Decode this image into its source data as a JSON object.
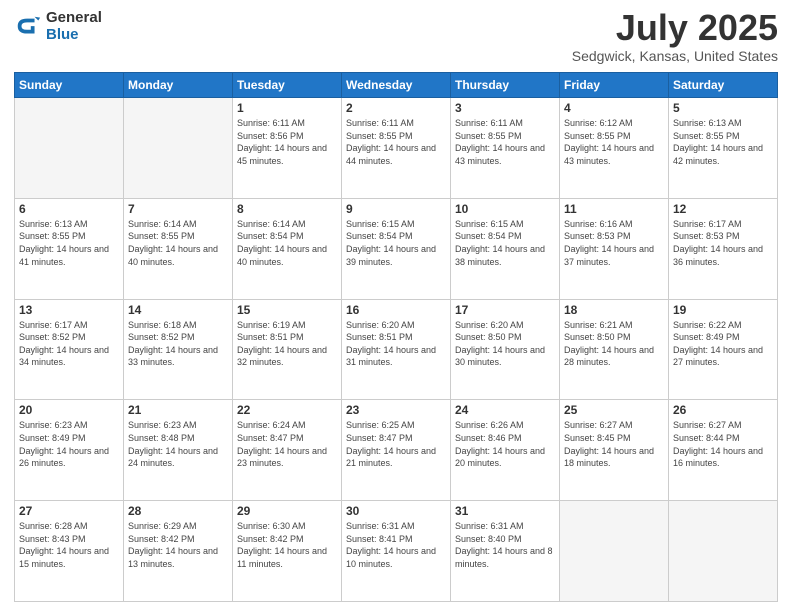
{
  "header": {
    "logo_general": "General",
    "logo_blue": "Blue",
    "title": "July 2025",
    "location": "Sedgwick, Kansas, United States"
  },
  "days_of_week": [
    "Sunday",
    "Monday",
    "Tuesday",
    "Wednesday",
    "Thursday",
    "Friday",
    "Saturday"
  ],
  "weeks": [
    [
      {
        "day": "",
        "empty": true
      },
      {
        "day": "",
        "empty": true
      },
      {
        "day": "1",
        "sunrise": "Sunrise: 6:11 AM",
        "sunset": "Sunset: 8:56 PM",
        "daylight": "Daylight: 14 hours and 45 minutes."
      },
      {
        "day": "2",
        "sunrise": "Sunrise: 6:11 AM",
        "sunset": "Sunset: 8:55 PM",
        "daylight": "Daylight: 14 hours and 44 minutes."
      },
      {
        "day": "3",
        "sunrise": "Sunrise: 6:11 AM",
        "sunset": "Sunset: 8:55 PM",
        "daylight": "Daylight: 14 hours and 43 minutes."
      },
      {
        "day": "4",
        "sunrise": "Sunrise: 6:12 AM",
        "sunset": "Sunset: 8:55 PM",
        "daylight": "Daylight: 14 hours and 43 minutes."
      },
      {
        "day": "5",
        "sunrise": "Sunrise: 6:13 AM",
        "sunset": "Sunset: 8:55 PM",
        "daylight": "Daylight: 14 hours and 42 minutes."
      }
    ],
    [
      {
        "day": "6",
        "sunrise": "Sunrise: 6:13 AM",
        "sunset": "Sunset: 8:55 PM",
        "daylight": "Daylight: 14 hours and 41 minutes."
      },
      {
        "day": "7",
        "sunrise": "Sunrise: 6:14 AM",
        "sunset": "Sunset: 8:55 PM",
        "daylight": "Daylight: 14 hours and 40 minutes."
      },
      {
        "day": "8",
        "sunrise": "Sunrise: 6:14 AM",
        "sunset": "Sunset: 8:54 PM",
        "daylight": "Daylight: 14 hours and 40 minutes."
      },
      {
        "day": "9",
        "sunrise": "Sunrise: 6:15 AM",
        "sunset": "Sunset: 8:54 PM",
        "daylight": "Daylight: 14 hours and 39 minutes."
      },
      {
        "day": "10",
        "sunrise": "Sunrise: 6:15 AM",
        "sunset": "Sunset: 8:54 PM",
        "daylight": "Daylight: 14 hours and 38 minutes."
      },
      {
        "day": "11",
        "sunrise": "Sunrise: 6:16 AM",
        "sunset": "Sunset: 8:53 PM",
        "daylight": "Daylight: 14 hours and 37 minutes."
      },
      {
        "day": "12",
        "sunrise": "Sunrise: 6:17 AM",
        "sunset": "Sunset: 8:53 PM",
        "daylight": "Daylight: 14 hours and 36 minutes."
      }
    ],
    [
      {
        "day": "13",
        "sunrise": "Sunrise: 6:17 AM",
        "sunset": "Sunset: 8:52 PM",
        "daylight": "Daylight: 14 hours and 34 minutes."
      },
      {
        "day": "14",
        "sunrise": "Sunrise: 6:18 AM",
        "sunset": "Sunset: 8:52 PM",
        "daylight": "Daylight: 14 hours and 33 minutes."
      },
      {
        "day": "15",
        "sunrise": "Sunrise: 6:19 AM",
        "sunset": "Sunset: 8:51 PM",
        "daylight": "Daylight: 14 hours and 32 minutes."
      },
      {
        "day": "16",
        "sunrise": "Sunrise: 6:20 AM",
        "sunset": "Sunset: 8:51 PM",
        "daylight": "Daylight: 14 hours and 31 minutes."
      },
      {
        "day": "17",
        "sunrise": "Sunrise: 6:20 AM",
        "sunset": "Sunset: 8:50 PM",
        "daylight": "Daylight: 14 hours and 30 minutes."
      },
      {
        "day": "18",
        "sunrise": "Sunrise: 6:21 AM",
        "sunset": "Sunset: 8:50 PM",
        "daylight": "Daylight: 14 hours and 28 minutes."
      },
      {
        "day": "19",
        "sunrise": "Sunrise: 6:22 AM",
        "sunset": "Sunset: 8:49 PM",
        "daylight": "Daylight: 14 hours and 27 minutes."
      }
    ],
    [
      {
        "day": "20",
        "sunrise": "Sunrise: 6:23 AM",
        "sunset": "Sunset: 8:49 PM",
        "daylight": "Daylight: 14 hours and 26 minutes."
      },
      {
        "day": "21",
        "sunrise": "Sunrise: 6:23 AM",
        "sunset": "Sunset: 8:48 PM",
        "daylight": "Daylight: 14 hours and 24 minutes."
      },
      {
        "day": "22",
        "sunrise": "Sunrise: 6:24 AM",
        "sunset": "Sunset: 8:47 PM",
        "daylight": "Daylight: 14 hours and 23 minutes."
      },
      {
        "day": "23",
        "sunrise": "Sunrise: 6:25 AM",
        "sunset": "Sunset: 8:47 PM",
        "daylight": "Daylight: 14 hours and 21 minutes."
      },
      {
        "day": "24",
        "sunrise": "Sunrise: 6:26 AM",
        "sunset": "Sunset: 8:46 PM",
        "daylight": "Daylight: 14 hours and 20 minutes."
      },
      {
        "day": "25",
        "sunrise": "Sunrise: 6:27 AM",
        "sunset": "Sunset: 8:45 PM",
        "daylight": "Daylight: 14 hours and 18 minutes."
      },
      {
        "day": "26",
        "sunrise": "Sunrise: 6:27 AM",
        "sunset": "Sunset: 8:44 PM",
        "daylight": "Daylight: 14 hours and 16 minutes."
      }
    ],
    [
      {
        "day": "27",
        "sunrise": "Sunrise: 6:28 AM",
        "sunset": "Sunset: 8:43 PM",
        "daylight": "Daylight: 14 hours and 15 minutes."
      },
      {
        "day": "28",
        "sunrise": "Sunrise: 6:29 AM",
        "sunset": "Sunset: 8:42 PM",
        "daylight": "Daylight: 14 hours and 13 minutes."
      },
      {
        "day": "29",
        "sunrise": "Sunrise: 6:30 AM",
        "sunset": "Sunset: 8:42 PM",
        "daylight": "Daylight: 14 hours and 11 minutes."
      },
      {
        "day": "30",
        "sunrise": "Sunrise: 6:31 AM",
        "sunset": "Sunset: 8:41 PM",
        "daylight": "Daylight: 14 hours and 10 minutes."
      },
      {
        "day": "31",
        "sunrise": "Sunrise: 6:31 AM",
        "sunset": "Sunset: 8:40 PM",
        "daylight": "Daylight: 14 hours and 8 minutes."
      },
      {
        "day": "",
        "empty": true
      },
      {
        "day": "",
        "empty": true
      }
    ]
  ]
}
